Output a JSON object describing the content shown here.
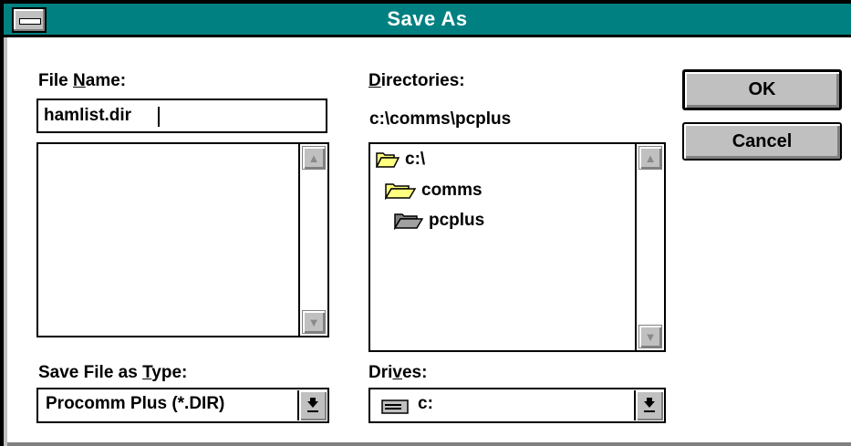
{
  "window": {
    "title": "Save As"
  },
  "file_name": {
    "label_pre": "File ",
    "label_accel": "N",
    "label_post": "ame:",
    "value": "hamlist.dir"
  },
  "file_list": {
    "items": []
  },
  "directories": {
    "label_accel": "D",
    "label_post": "irectories:",
    "current_path": "c:\\comms\\pcplus",
    "items": [
      {
        "name": "c:\\",
        "icon": "open-folder-icon"
      },
      {
        "name": "comms",
        "icon": "open-folder-icon"
      },
      {
        "name": "pcplus",
        "icon": "open-folder-selected-icon"
      }
    ]
  },
  "buttons": {
    "ok": "OK",
    "cancel": "Cancel"
  },
  "save_type": {
    "label_pre": "Save File as ",
    "label_accel": "T",
    "label_post": "ype:",
    "value": "Procomm Plus (*.DIR)"
  },
  "drives": {
    "label_pre": "Dri",
    "label_accel": "v",
    "label_post": "es:",
    "value": "c:",
    "icon": "drive-icon"
  },
  "colors": {
    "titlebar": "#008080",
    "face": "#c0c0c0",
    "shadow": "#808080"
  }
}
